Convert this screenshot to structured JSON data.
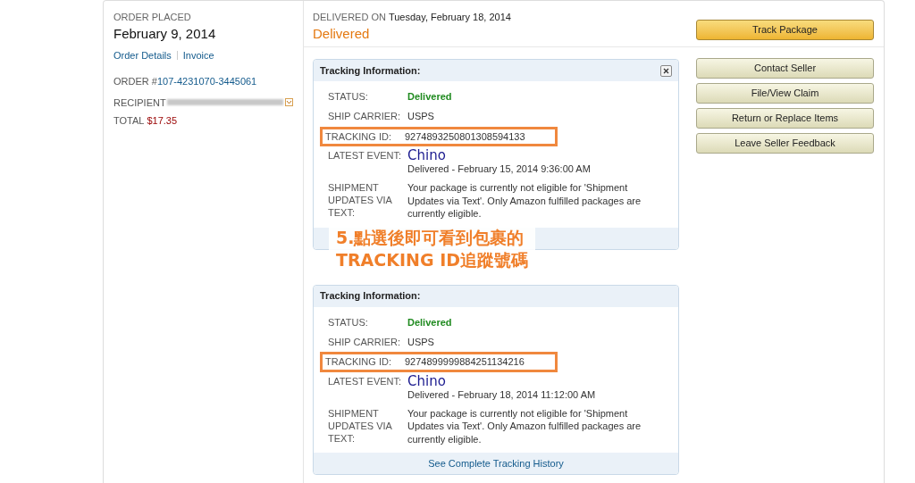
{
  "order": {
    "placed_label": "ORDER PLACED",
    "date": "February 9, 2014",
    "links": [
      "Order Details",
      "Invoice"
    ],
    "order_label": "ORDER #",
    "order_number": "107-4231070-3445061",
    "recipient_label": "RECIPIENT",
    "total_label": "TOTAL",
    "total": "$17.35"
  },
  "delivery": {
    "delivered_on_label": "DELIVERED ON",
    "date": "Tuesday, February 18, 2014",
    "status": "Delivered"
  },
  "tracking_panels": [
    {
      "title": "Tracking Information:",
      "closable": true,
      "rows": [
        {
          "kind": "status",
          "label": "STATUS:",
          "value": "Delivered"
        },
        {
          "kind": "text",
          "label": "SHIP CARRIER:",
          "value": "USPS"
        },
        {
          "kind": "tracking_id",
          "label": "TRACKING ID:",
          "value": "9274893250801308594133"
        },
        {
          "kind": "event",
          "label": "LATEST EVENT:",
          "annotation": "Chino",
          "value": "Delivered - February 15, 2014 9:36:00 AM"
        },
        {
          "kind": "text",
          "label": "SHIPMENT UPDATES VIA TEXT:",
          "value": "Your package is currently not eligible for 'Shipment Updates via Text'. Only Amazon fulfilled packages are currently eligible."
        }
      ]
    },
    {
      "title": "Tracking Information:",
      "closable": false,
      "footer_link": "See Complete Tracking History",
      "rows": [
        {
          "kind": "status",
          "label": "STATUS:",
          "value": "Delivered"
        },
        {
          "kind": "text",
          "label": "SHIP CARRIER:",
          "value": "USPS"
        },
        {
          "kind": "tracking_id",
          "label": "TRACKING ID:",
          "value": "9274899999884251134216"
        },
        {
          "kind": "event",
          "label": "LATEST EVENT:",
          "annotation": "Chino",
          "value": "Delivered - February 18, 2014 11:12:00 AM"
        },
        {
          "kind": "text",
          "label": "SHIPMENT UPDATES VIA TEXT:",
          "value": "Your package is currently not eligible for 'Shipment Updates via Text'. Only Amazon fulfilled packages are currently eligible."
        }
      ]
    }
  ],
  "callout": {
    "lines": [
      "5.點選後即可看到包裹的",
      "TRACKING ID追蹤號碼"
    ]
  },
  "actions": [
    {
      "label": "Track Package",
      "kind": "primary"
    },
    {
      "label": "Contact Seller",
      "kind": "secondary"
    },
    {
      "label": "File/View Claim",
      "kind": "secondary"
    },
    {
      "label": "Return or Replace Items",
      "kind": "secondary"
    },
    {
      "label": "Leave Seller Feedback",
      "kind": "secondary"
    }
  ]
}
